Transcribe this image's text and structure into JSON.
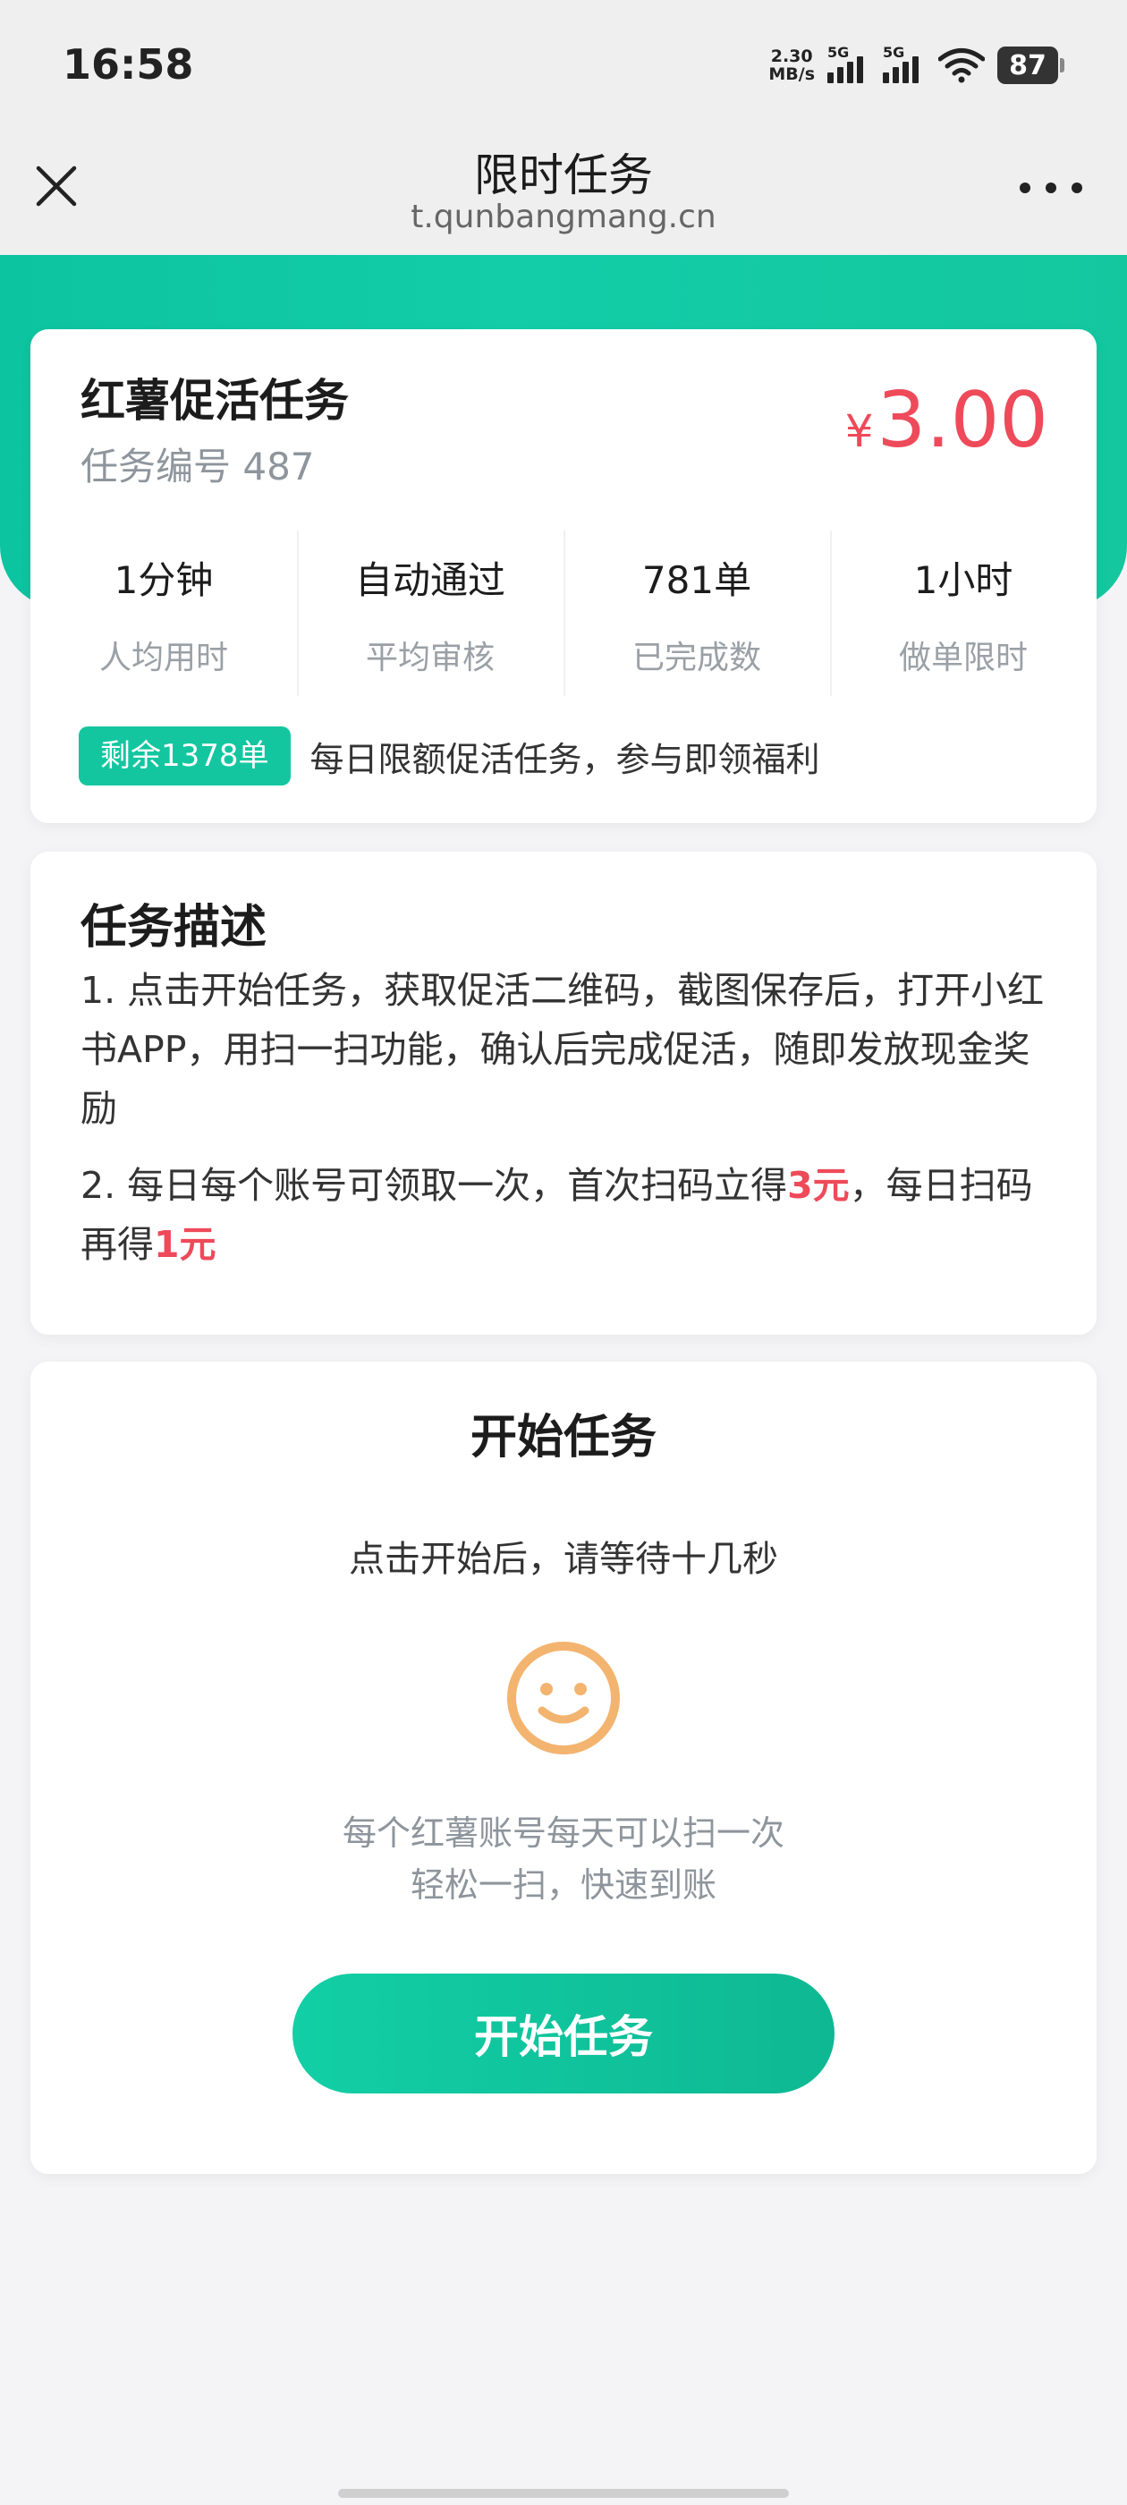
{
  "status_bar": {
    "time": "16:58",
    "net_speed_value": "2.30",
    "net_speed_unit": "MB/s",
    "signal1_label": "5G",
    "signal2_label": "5G",
    "battery": "87"
  },
  "nav": {
    "title": "限时任务",
    "subtitle": "t.qunbangmang.cn"
  },
  "task": {
    "title": "红薯促活任务",
    "id_text": "任务编号 487",
    "price_symbol": "¥",
    "price": "3.00",
    "stats": [
      {
        "value": "1分钟",
        "label": "人均用时"
      },
      {
        "value": "自动通过",
        "label": "平均审核"
      },
      {
        "value": "781单",
        "label": "已完成数"
      },
      {
        "value": "1小时",
        "label": "做单限时"
      }
    ],
    "remaining_badge": "剩余1378单",
    "remaining_text": "每日限额促活任务，参与即领福利"
  },
  "description": {
    "title": "任务描述",
    "item1": "1. 点击开始任务，获取促活二维码，截图保存后，打开小红书APP，用扫一扫功能，确认后完成促活，随即发放现金奖励",
    "item2_part1": "2. 每日每个账号可领取一次，首次扫码立得",
    "item2_hl1": "3元",
    "item2_part2": "，每日扫码再得",
    "item2_hl2": "1元"
  },
  "start": {
    "title": "开始任务",
    "hint": "点击开始后，请等待十几秒",
    "icon": "smiley-icon",
    "note_line1": "每个红薯账号每天可以扫一次",
    "note_line2": "轻松一扫，快速到账",
    "button_label": "开始任务"
  },
  "colors": {
    "accent": "#13c6a0",
    "price": "#ee4a5a",
    "smiley": "#f3b46f"
  }
}
